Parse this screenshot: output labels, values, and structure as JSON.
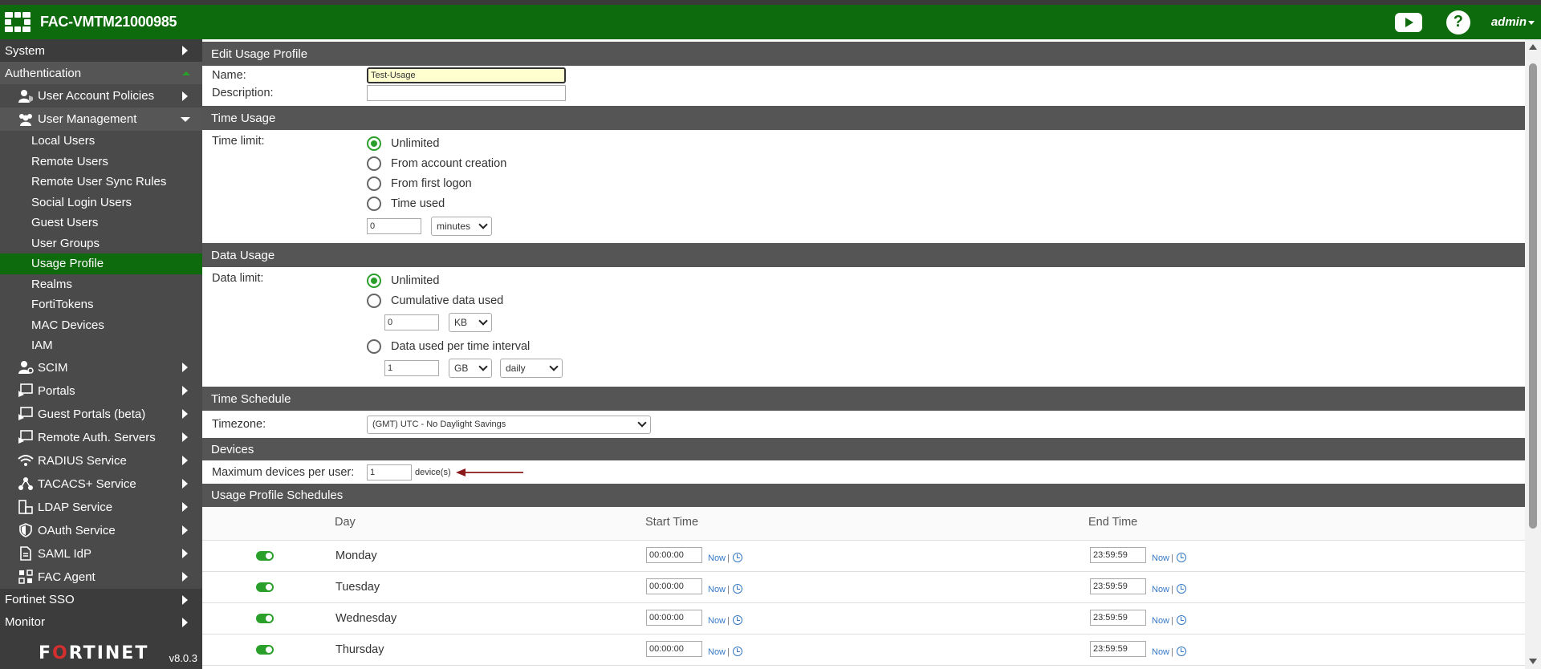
{
  "header": {
    "hostname": "FAC-VMTM21000985",
    "help_symbol": "?",
    "user": "admin",
    "icons": [
      "apps-grid-icon",
      "youtube-icon",
      "help-icon"
    ]
  },
  "sidebar": {
    "system": "System",
    "authentication": "Authentication",
    "user_account_policies": "User Account Policies",
    "user_management": "User Management",
    "leaves": [
      "Local Users",
      "Remote Users",
      "Remote User Sync Rules",
      "Social Login Users",
      "Guest Users",
      "User Groups",
      "Usage Profile",
      "Realms",
      "FortiTokens",
      "MAC Devices",
      "IAM"
    ],
    "scim": "SCIM",
    "portals": "Portals",
    "guest_portals": "Guest Portals (beta)",
    "remote_auth": "Remote Auth. Servers",
    "radius": "RADIUS Service",
    "tacacs": "TACACS+ Service",
    "ldap": "LDAP Service",
    "oauth": "OAuth Service",
    "saml": "SAML IdP",
    "fac_agent": "FAC Agent",
    "fortinet_sso": "Fortinet SSO",
    "monitor": "Monitor",
    "brand_pre": "F",
    "brand_o": "O",
    "brand_post": "RTINET",
    "version": "v8.0.3"
  },
  "form": {
    "edit_title": "Edit Usage Profile",
    "name_label": "Name:",
    "name_value": "Test-Usage",
    "description_label": "Description:",
    "description_value": "",
    "time_usage_title": "Time Usage",
    "time_limit_label": "Time limit:",
    "time_options": [
      "Unlimited",
      "From account creation",
      "From first logon",
      "Time used"
    ],
    "time_value": "0",
    "time_unit": "minutes",
    "data_usage_title": "Data Usage",
    "data_limit_label": "Data limit:",
    "data_unlimited": "Unlimited",
    "data_cumulative": "Cumulative data used",
    "cumulative_value": "0",
    "cumulative_unit": "KB",
    "data_per_interval": "Data used per time interval",
    "interval_value": "1",
    "interval_unit": "GB",
    "interval_period": "daily",
    "time_schedule_title": "Time Schedule",
    "timezone_label": "Timezone:",
    "timezone_value": "(GMT) UTC - No Daylight Savings",
    "devices_title": "Devices",
    "max_devices_label": "Maximum devices per user:",
    "max_devices_value": "1",
    "devices_unit": "device(s)"
  },
  "schedules": {
    "title": "Usage Profile Schedules",
    "col_day": "Day",
    "col_start": "Start Time",
    "col_end": "End Time",
    "now_label": "Now",
    "separator": "|",
    "rows": [
      {
        "day": "Monday",
        "start": "00:00:00",
        "end": "23:59:59",
        "enabled": true
      },
      {
        "day": "Tuesday",
        "start": "00:00:00",
        "end": "23:59:59",
        "enabled": true
      },
      {
        "day": "Wednesday",
        "start": "00:00:00",
        "end": "23:59:59",
        "enabled": true
      },
      {
        "day": "Thursday",
        "start": "00:00:00",
        "end": "23:59:59",
        "enabled": true
      }
    ]
  },
  "colors": {
    "brand_green": "#0d6a0d",
    "accent_green": "#2aa02a",
    "section_header": "#555555",
    "sidebar_bg": "#3c3c3c",
    "arrow_annotation": "#8b1a1a"
  }
}
